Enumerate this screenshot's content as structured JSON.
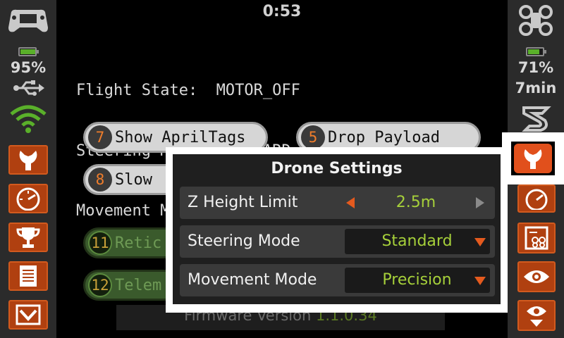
{
  "timer": "0:53",
  "left_bar": {
    "battery_percent_label": "95%",
    "battery_level": 0.95,
    "icons": [
      "gamepad-icon",
      "battery-icon",
      "usb-icon",
      "wifi-icon"
    ],
    "buttons": [
      "wrench-icon",
      "gauge-icon",
      "trophy-icon",
      "document-icon",
      "inbox-download-icon"
    ]
  },
  "right_bar": {
    "battery_percent_label": "71%",
    "battery_level": 0.71,
    "flight_time": "7min",
    "icons": [
      "drone-icon",
      "battery-icon",
      "logo-icon"
    ],
    "buttons": [
      "wrench-icon",
      "gauge-icon",
      "drone-list-icon",
      "eye-icon",
      "eye-down-icon"
    ]
  },
  "status": {
    "flight_state": "Flight State:  MOTOR_OFF",
    "steering_mode": "Steering Mode: STANDARD",
    "movement_mode": "Movement Mode: PRECISION"
  },
  "actions": [
    {
      "num": "7",
      "label": "Show AprilTags"
    },
    {
      "num": "5",
      "label": "Drop Payload"
    },
    {
      "num": "8",
      "label": "Slow"
    },
    {
      "num": "11",
      "label": "Retic"
    },
    {
      "num": "12",
      "label": "Telem"
    }
  ],
  "firmware": {
    "label": "Firmware Version",
    "version": "1.1.0.34"
  },
  "modal": {
    "title": "Drone Settings",
    "z_height": {
      "label": "Z Height Limit",
      "value": "2.5m"
    },
    "steering": {
      "label": "Steering Mode",
      "value": "Standard"
    },
    "movement": {
      "label": "Movement Mode",
      "value": "Precision"
    }
  },
  "colors": {
    "accent": "#e1501c",
    "value_green": "#a6d03a",
    "wifi_green": "#5ab02a"
  }
}
